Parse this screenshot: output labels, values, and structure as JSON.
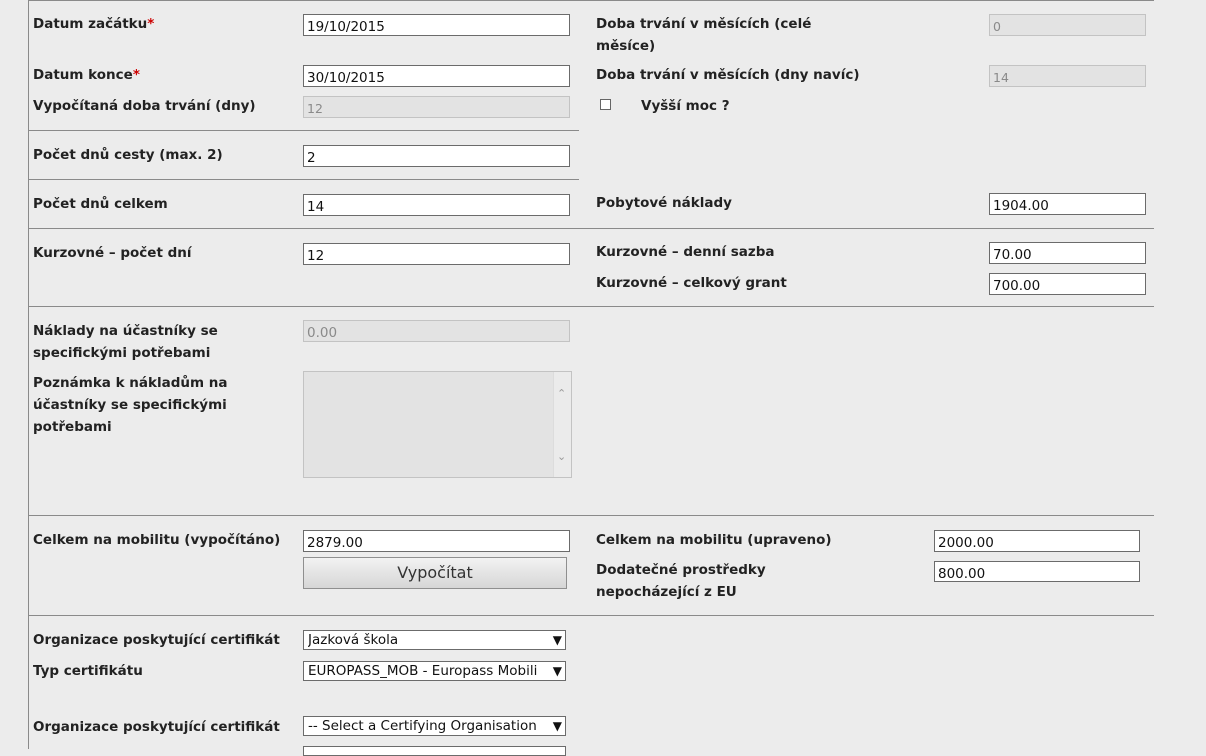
{
  "form": {
    "start_date_label": "Datum začátku",
    "required_mark": "*",
    "start_date_value": "19/10/2015",
    "end_date_label": "Datum konce",
    "end_date_value": "30/10/2015",
    "calc_duration_label": "Vypočítaná doba trvání (dny)",
    "calc_duration_value": "12",
    "months_full_label": "Doba trvání v měsících (celé měsíce)",
    "months_full_value": "0",
    "months_extra_label": "Doba trvání v měsících (dny navíc)",
    "months_extra_value": "14",
    "force_majeure_label": "Vyšší moc ?",
    "travel_days_label": "Počet dnů cesty (max. 2)",
    "travel_days_value": "2",
    "total_days_label": "Počet dnů celkem",
    "total_days_value": "14",
    "subsistence_label": "Pobytové náklady",
    "subsistence_value": "1904.00",
    "course_days_label": "Kurzovné – počet dní",
    "course_days_value": "12",
    "course_rate_label": "Kurzovné – denní sazba",
    "course_rate_value": "70.00",
    "course_total_label": "Kurzovné – celkový grant",
    "course_total_value": "700.00",
    "special_needs_label": "Náklady na účastníky se specifickými potřebami",
    "special_needs_value": "0.00",
    "special_needs_note_label": "Poznámka k nákladům na účastníky se specifickými potřebami",
    "total_calc_label": "Celkem na mobilitu (vypočítáno)",
    "total_calc_value": "2879.00",
    "calculate_button": "Vypočítat",
    "total_adjusted_label": "Celkem na mobilitu (upraveno)",
    "total_adjusted_value": "2000.00",
    "extra_funds_label": "Dodatečné prostředky nepocházející z EU",
    "extra_funds_value": "800.00",
    "cert_org_label": "Organizace poskytující certifikát",
    "cert_org_value": "Jazková škola",
    "cert_type_label": "Typ certifikátu",
    "cert_type_value": "EUROPASS_MOB - Europass Mobili",
    "cert_org2_label": "Organizace poskytující certifikát",
    "cert_org2_value": "-- Select a Certifying Organisation"
  }
}
